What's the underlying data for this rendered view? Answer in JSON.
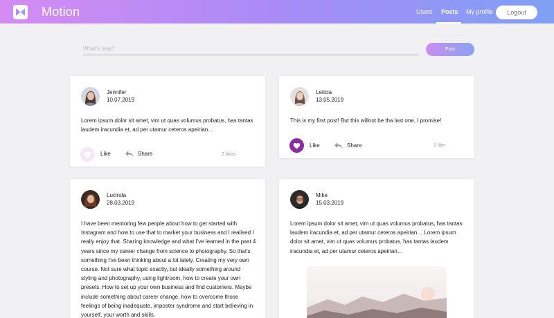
{
  "header": {
    "brand": "Motion",
    "nav": {
      "users": "Users",
      "posts": "Posts",
      "profile": "My profile"
    },
    "logout": "Logout"
  },
  "composer": {
    "placeholder": "What's new?",
    "post_label": "Post"
  },
  "posts": [
    {
      "author": "Jennifer",
      "date": "10.07.2019",
      "text": "Lorem ipsum dolor sit amet, vim ut quas volumus probatus, has tantas laudem iracundia et, ad per utamur ceteros apeirian…",
      "like_label": "Like",
      "share_label": "Share",
      "likes": "2 likes",
      "liked": false
    },
    {
      "author": "Leticia",
      "date": "13.05.2019",
      "text": "This is my first post! But this willnot be tha last one, I promise!",
      "like_label": "Like",
      "share_label": "Share",
      "likes": "1 like",
      "liked": true
    },
    {
      "author": "Lucinda",
      "date": "28.03.2019",
      "text": "I have been mentoring few people about how to get started with Instagram and how to use that to market your business and I realised I really enjoy that. Sharing knowledge and what I've learned in the past 4 years since my career change from science to photography. So that's something I've been thinking about a lot lately. Creating my very own course. Not sure what topic exactly, but ideally something around styling and photography, using lightroom, how to create your own presets. How to set up your own business and find customers. Maybe include something about career change, how to overcome those feelings of being inadequate, imposter syndrome and start believing in yourself, your worth and skills."
    },
    {
      "author": "Mike",
      "date": "15.03.2019",
      "text": "Lorem ipsum dolor sit amet, vim ut quas volumus probatus, has tantas laudem iracundia et, ad per utamur ceteros apeirian… Lorem ipsum dolor sit amet, vim ut quas volumus probatus, has tantas laudem iracundia et, ad per utamur ceteros apeirian…"
    }
  ],
  "colors": {
    "header_gradient": [
      "#d48cf3",
      "#a98bf6",
      "#7fa0f4"
    ],
    "liked_accent": "#8e2aa8",
    "unliked_circle": "#f6e6fa"
  },
  "icons": [
    "motion-logo-icon",
    "heart-icon",
    "share-arrow-icon"
  ]
}
